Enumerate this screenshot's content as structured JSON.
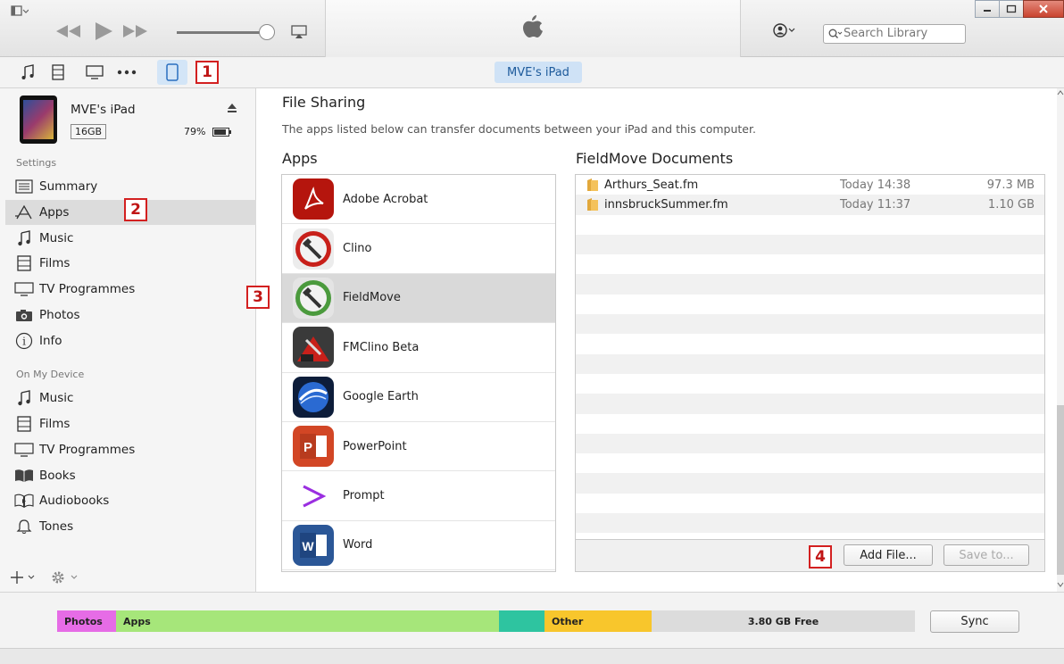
{
  "toolbar": {
    "search_placeholder": "Search Library",
    "device_tab": "MVE's iPad"
  },
  "annotations": [
    "1",
    "2",
    "3",
    "4"
  ],
  "device": {
    "name": "MVE's iPad",
    "capacity": "16GB",
    "battery": "79%"
  },
  "sidebar": {
    "settings_header": "Settings",
    "settings_items": [
      {
        "label": "Summary",
        "icon": "summary-icon"
      },
      {
        "label": "Apps",
        "icon": "apps-icon"
      },
      {
        "label": "Music",
        "icon": "music-icon"
      },
      {
        "label": "Films",
        "icon": "film-icon"
      },
      {
        "label": "TV Programmes",
        "icon": "tv-icon"
      },
      {
        "label": "Photos",
        "icon": "camera-icon"
      },
      {
        "label": "Info",
        "icon": "info-icon"
      }
    ],
    "device_header": "On My Device",
    "device_items": [
      {
        "label": "Music",
        "icon": "music-icon"
      },
      {
        "label": "Films",
        "icon": "film-icon"
      },
      {
        "label": "TV Programmes",
        "icon": "tv-icon"
      },
      {
        "label": "Books",
        "icon": "book-icon"
      },
      {
        "label": "Audiobooks",
        "icon": "audiobook-icon"
      },
      {
        "label": "Tones",
        "icon": "bell-icon"
      }
    ]
  },
  "main": {
    "title": "File Sharing",
    "description": "The apps listed below can transfer documents between your iPad and this computer.",
    "apps_header": "Apps",
    "docs_header": "FieldMove Documents",
    "apps": [
      {
        "name": "Adobe Acrobat",
        "color": "#b5150d"
      },
      {
        "name": "Clino",
        "color": "#c8201a"
      },
      {
        "name": "FieldMove",
        "color": "#4b9a3d"
      },
      {
        "name": "FMClino Beta",
        "color": "#444444"
      },
      {
        "name": "Google Earth",
        "color": "#1c4f9c"
      },
      {
        "name": "PowerPoint",
        "color": "#d24625"
      },
      {
        "name": "Prompt",
        "color": "#8a2be2"
      },
      {
        "name": "Word",
        "color": "#2b5797"
      }
    ],
    "documents": [
      {
        "name": "Arthurs_Seat.fm",
        "date": "Today 14:38",
        "size": "97.3 MB"
      },
      {
        "name": "innsbruckSummer.fm",
        "date": "Today 11:37",
        "size": "1.10 GB"
      }
    ],
    "add_file_label": "Add File...",
    "save_to_label": "Save to..."
  },
  "storage": {
    "photos_label": "Photos",
    "apps_label": "Apps",
    "other_label": "Other",
    "free_label": "3.80 GB Free",
    "sync_label": "Sync",
    "colors": {
      "photos": "#e66ce6",
      "apps": "#a6e67a",
      "teal": "#2ec4a0",
      "other": "#f8c62c",
      "free": "#dcdcdc"
    }
  }
}
